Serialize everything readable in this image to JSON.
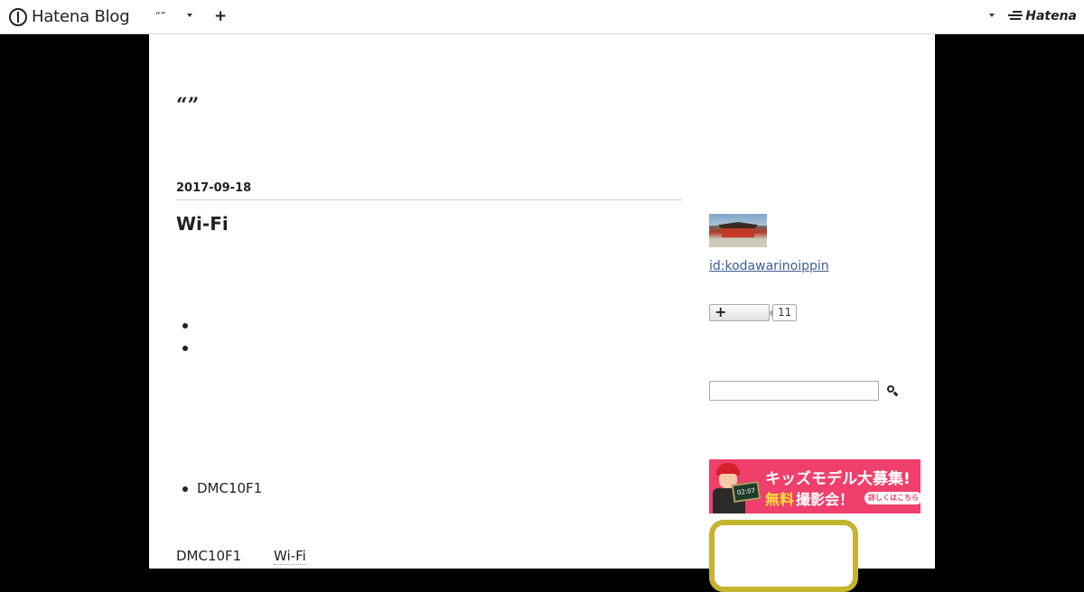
{
  "globalbar": {
    "logo_text": "Hatena Blog",
    "blog_name": "“”",
    "hatena_text": "Hatena"
  },
  "blog": {
    "title": "“”"
  },
  "entry": {
    "date": "2017-09-18",
    "title": "Wi-Fi",
    "list_items": [
      "",
      "",
      "DMC10F1"
    ],
    "body_model": "DMC10F1",
    "body_wifi": "Wi-Fi"
  },
  "sidebar": {
    "author_id": "id:kodawarinoippin",
    "subscriber_count": "11",
    "search_placeholder": ""
  },
  "ad": {
    "headline": "キッズモデル大募集!",
    "free": "無料",
    "event": "撮影会！",
    "cta": "詳しくはこちら",
    "board_text": "02:07"
  },
  "colors": {
    "accent_link": "#3f5f8f",
    "ad_pink": "#ef3f6c",
    "ad_yellow": "#ffe13a",
    "frame_gold": "#c4b52e"
  },
  "icons": [
    "hatena-blog-logo-icon",
    "caret-down-icon",
    "plus-icon",
    "hatena-logo-icon",
    "search-icon"
  ]
}
